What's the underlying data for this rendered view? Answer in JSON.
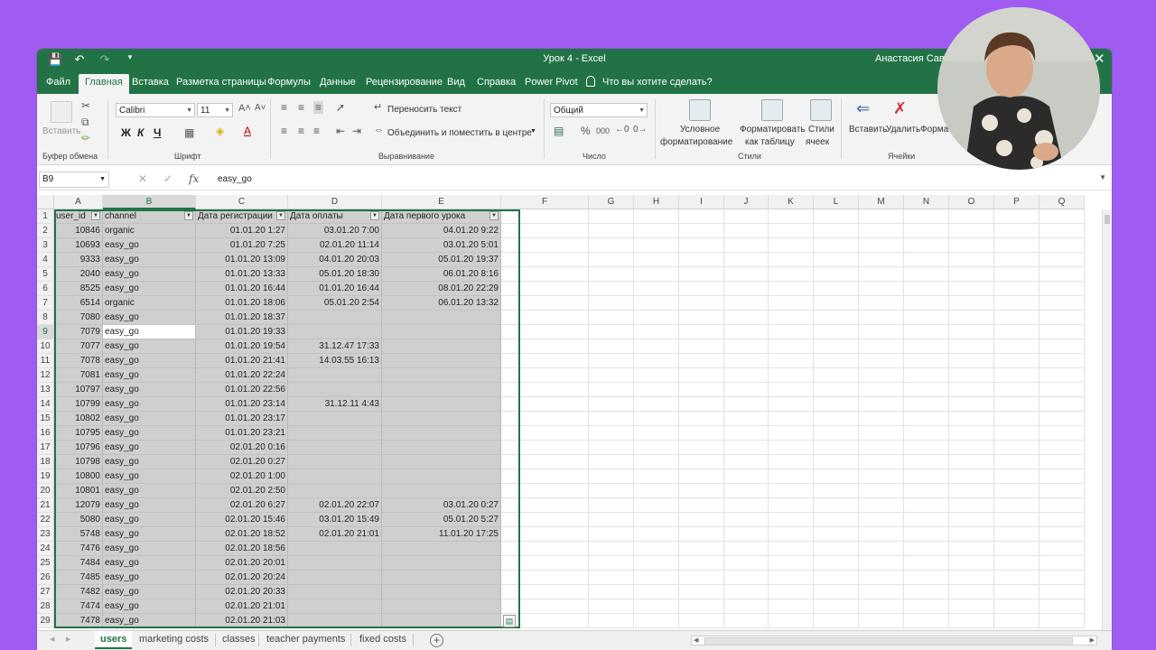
{
  "window": {
    "title": "Урок 4  -  Excel",
    "user_name": "Анастасия Савчен"
  },
  "ribbon_tabs": [
    "Файл",
    "Главная",
    "Вставка",
    "Разметка страницы",
    "Формулы",
    "Данные",
    "Рецензирование",
    "Вид",
    "Справка",
    "Power Pivot"
  ],
  "active_tab": "Главная",
  "tell_me": "Что вы хотите сделать?",
  "ribbon": {
    "clipboard": {
      "paste": "Вставить",
      "label": "Буфер обмена"
    },
    "font": {
      "name": "Calibri",
      "size": "11",
      "bold": "Ж",
      "italic": "К",
      "underline": "Ч",
      "label": "Шрифт"
    },
    "alignment": {
      "wrap": "Переносить текст",
      "merge": "Объединить и поместить в центре",
      "label": "Выравнивание"
    },
    "number": {
      "format": "Общий",
      "percent": "%",
      "thousands": "000",
      "label": "Число"
    },
    "styles": {
      "conditional_1": "Условное",
      "conditional_2": "форматирование",
      "as_table_1": "Форматировать",
      "as_table_2": "как таблицу",
      "cell_styles_1": "Стили",
      "cell_styles_2": "ячеек",
      "label": "Стили"
    },
    "cells": {
      "insert": "Вставить",
      "delete": "Удалить",
      "format": "Форма",
      "label": "Ячейки"
    }
  },
  "formula_bar": {
    "name_box": "B9",
    "value": "easy_go",
    "fx": "fx"
  },
  "columns": [
    "A",
    "B",
    "C",
    "D",
    "E",
    "F",
    "G",
    "H",
    "I",
    "J",
    "K",
    "L",
    "M",
    "N",
    "O",
    "P",
    "Q"
  ],
  "header_row": [
    "user_id",
    "channel",
    "Дата регистрации",
    "Дата оплаты",
    "Дата первого урока"
  ],
  "rows": [
    [
      "10846",
      "organic",
      "01.01.20 1:27",
      "03.01.20 7:00",
      "04.01.20 9:22"
    ],
    [
      "10693",
      "easy_go",
      "01.01.20 7:25",
      "02.01.20 11:14",
      "03.01.20 5:01"
    ],
    [
      "9333",
      "easy_go",
      "01.01.20 13:09",
      "04.01.20 20:03",
      "05.01.20 19:37"
    ],
    [
      "2040",
      "easy_go",
      "01.01.20 13:33",
      "05.01.20 18:30",
      "06.01.20 8:16"
    ],
    [
      "8525",
      "easy_go",
      "01.01.20 16:44",
      "01.01.20 16:44",
      "08.01.20 22:29"
    ],
    [
      "6514",
      "organic",
      "01.01.20 18:06",
      "05.01.20 2:54",
      "06.01.20 13:32"
    ],
    [
      "7080",
      "easy_go",
      "01.01.20 18:37",
      "",
      ""
    ],
    [
      "7079",
      "easy_go",
      "01.01.20 19:33",
      "",
      ""
    ],
    [
      "7077",
      "easy_go",
      "01.01.20 19:54",
      "31.12.47 17:33",
      ""
    ],
    [
      "7078",
      "easy_go",
      "01.01.20 21:41",
      "14.03.55 16:13",
      ""
    ],
    [
      "7081",
      "easy_go",
      "01.01.20 22:24",
      "",
      ""
    ],
    [
      "10797",
      "easy_go",
      "01.01.20 22:56",
      "",
      ""
    ],
    [
      "10799",
      "easy_go",
      "01.01.20 23:14",
      "31.12.11 4:43",
      ""
    ],
    [
      "10802",
      "easy_go",
      "01.01.20 23:17",
      "",
      ""
    ],
    [
      "10795",
      "easy_go",
      "01.01.20 23:21",
      "",
      ""
    ],
    [
      "10796",
      "easy_go",
      "02.01.20 0:16",
      "",
      ""
    ],
    [
      "10798",
      "easy_go",
      "02.01.20 0:27",
      "",
      ""
    ],
    [
      "10800",
      "easy_go",
      "02.01.20 1:00",
      "",
      ""
    ],
    [
      "10801",
      "easy_go",
      "02.01.20 2:50",
      "",
      ""
    ],
    [
      "12079",
      "easy_go",
      "02.01.20 6:27",
      "02.01.20 22:07",
      "03.01.20 0:27"
    ],
    [
      "5080",
      "easy_go",
      "02.01.20 15:46",
      "03.01.20 15:49",
      "05.01.20 5:27"
    ],
    [
      "5748",
      "easy_go",
      "02.01.20 18:52",
      "02.01.20 21:01",
      "11.01.20 17:25"
    ],
    [
      "7476",
      "easy_go",
      "02.01.20 18:56",
      "",
      ""
    ],
    [
      "7484",
      "easy_go",
      "02.01.20 20:01",
      "",
      ""
    ],
    [
      "7485",
      "easy_go",
      "02.01.20 20:24",
      "",
      ""
    ],
    [
      "7482",
      "easy_go",
      "02.01.20 20:33",
      "",
      ""
    ],
    [
      "7474",
      "easy_go",
      "02.01.20 21:01",
      "",
      ""
    ],
    [
      "7478",
      "easy_go",
      "02.01.20 21:03",
      "",
      ""
    ]
  ],
  "active_cell": "B9",
  "sheet_tabs": [
    "users",
    "marketing costs",
    "classes",
    "teacher payments",
    "fixed costs"
  ],
  "active_sheet": "users",
  "colors": {
    "excel_green": "#217346",
    "background": "#a05cf0"
  }
}
